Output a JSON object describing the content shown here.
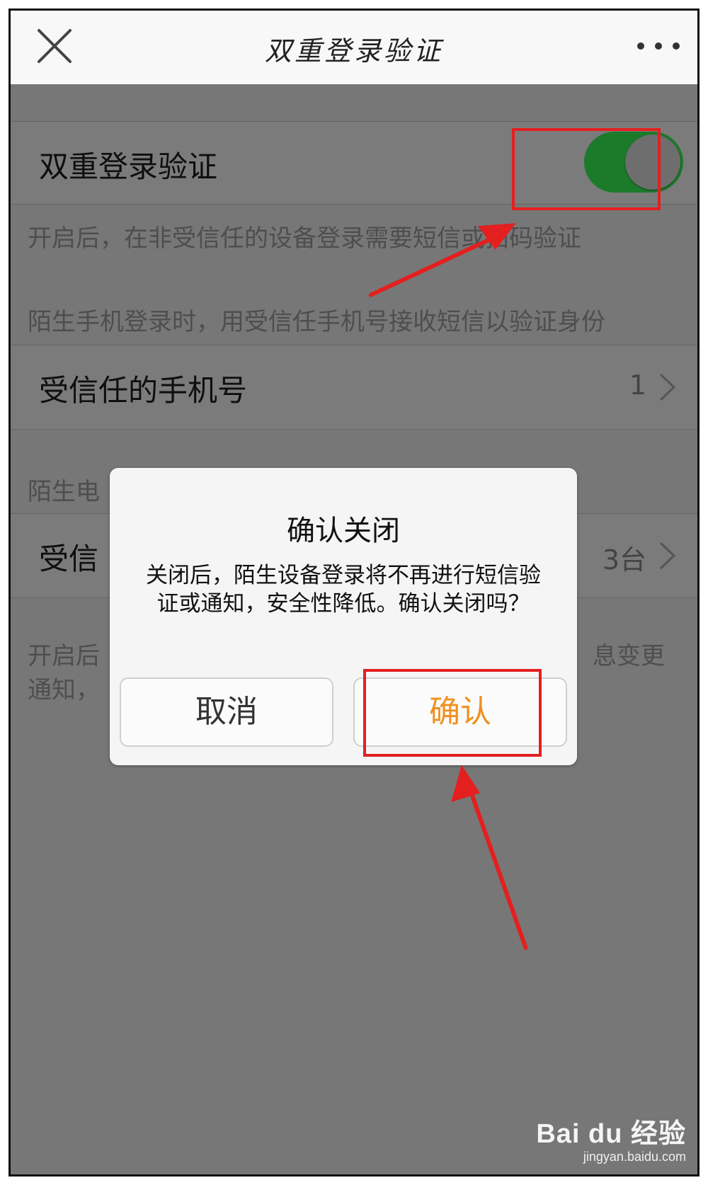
{
  "header": {
    "title": "双重登录验证",
    "close_icon": "close-icon",
    "more_icon": "more-icon"
  },
  "settings": {
    "two_step": {
      "label": "双重登录验证",
      "enabled": true,
      "toggle_color": "#1c7a2b"
    },
    "desc_1": "开启后，在非受信任的设备登录需要短信或扫码验证",
    "desc_2": "陌生手机登录时，用受信任手机号接收短信以验证身份",
    "trusted_phone": {
      "label": "受信任的手机号",
      "count": "1"
    },
    "desc_3_partial": "陌生电",
    "trusted_device": {
      "label_partial": "受信",
      "count": "3台"
    },
    "desc_4_partial_left": "开启后",
    "desc_4_partial_right": "息变更",
    "desc_5_partial": "通知，"
  },
  "dialog": {
    "title": "确认关闭",
    "body": "关闭后，陌生设备登录将不再进行短信验证或通知，安全性降低。确认关闭吗？",
    "cancel": "取消",
    "confirm": "确认",
    "confirm_color": "#f09020"
  },
  "annotations": {
    "highlight_color": "#e41f1f"
  },
  "watermark": {
    "brand": "Bai du 经验",
    "domain": "jingyan.baidu.com"
  }
}
